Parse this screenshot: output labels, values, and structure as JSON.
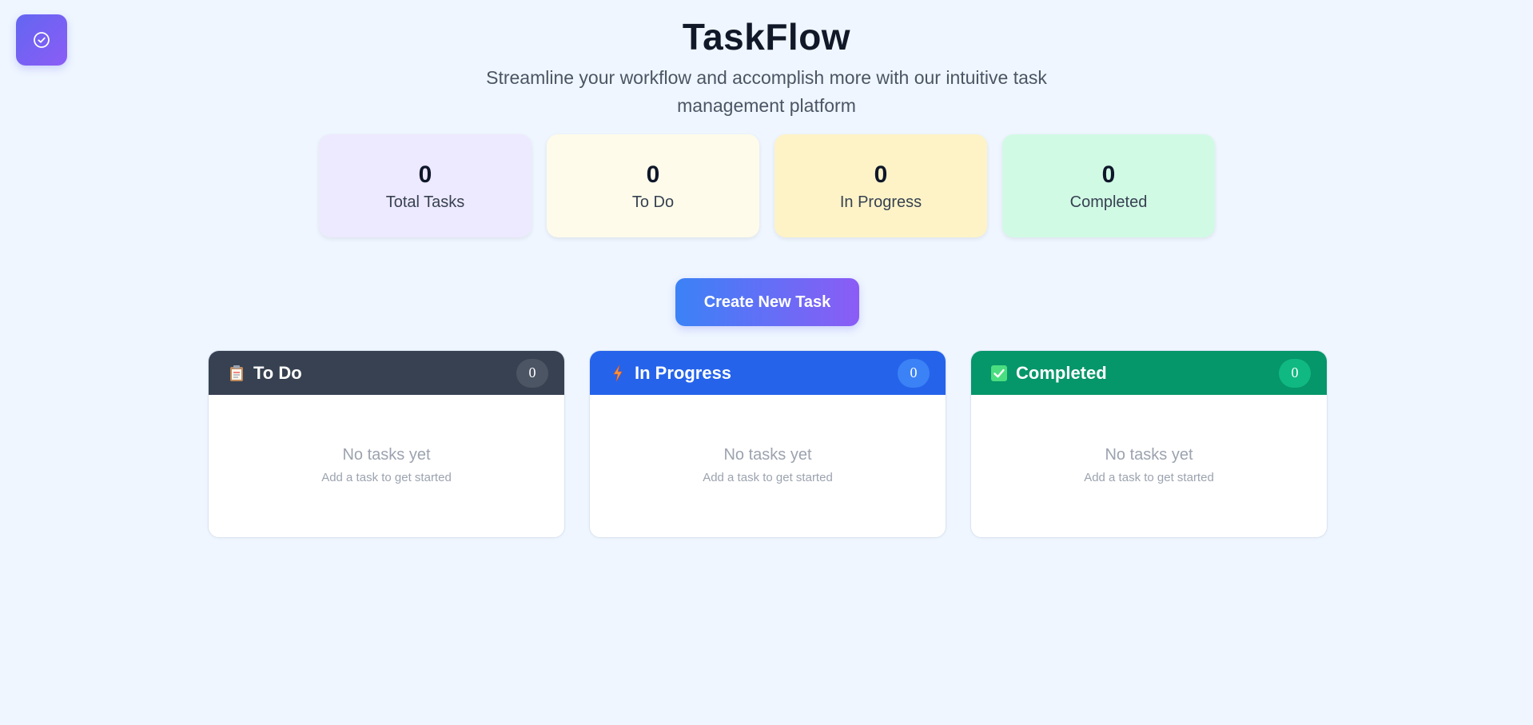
{
  "app": {
    "title": "TaskFlow",
    "subtitle": "Streamline your workflow and accomplish more with our intuitive task management platform"
  },
  "stats": [
    {
      "value": "0",
      "label": "Total Tasks",
      "color": "#ede9fe"
    },
    {
      "value": "0",
      "label": "To Do",
      "color": "#fefbea"
    },
    {
      "value": "0",
      "label": "In Progress",
      "color": "#fef3c7"
    },
    {
      "value": "0",
      "label": "Completed",
      "color": "#d1fae5"
    }
  ],
  "create_button": {
    "label": "Create New Task"
  },
  "columns": [
    {
      "title": "To Do",
      "icon": "clipboard-icon",
      "count": "0",
      "header_color": "#374151",
      "badge_color": "#4b5563",
      "empty_title": "No tasks yet",
      "empty_subtitle": "Add a task to get started"
    },
    {
      "title": "In Progress",
      "icon": "lightning-icon",
      "count": "0",
      "header_color": "#2563eb",
      "badge_color": "#3b82f6",
      "empty_title": "No tasks yet",
      "empty_subtitle": "Add a task to get started"
    },
    {
      "title": "Completed",
      "icon": "check-box-icon",
      "count": "0",
      "header_color": "#059669",
      "badge_color": "#10b981",
      "empty_title": "No tasks yet",
      "empty_subtitle": "Add a task to get started"
    }
  ]
}
